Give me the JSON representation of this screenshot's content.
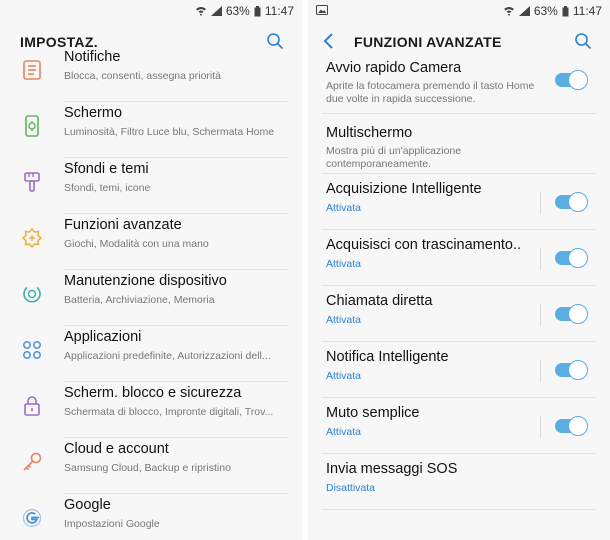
{
  "status": {
    "battery": "63%",
    "time": "11:47"
  },
  "left": {
    "title": "IMPOSTAZ.",
    "items": [
      {
        "title": "Notifiche",
        "subtitle": "Blocca, consenti, assegna priorità",
        "icon": "notifications-icon"
      },
      {
        "title": "Schermo",
        "subtitle": "Luminosità, Filtro Luce blu, Schermata Home",
        "icon": "display-icon"
      },
      {
        "title": "Sfondi e temi",
        "subtitle": "Sfondi, temi, icone",
        "icon": "paintbrush-icon"
      },
      {
        "title": "Funzioni avanzate",
        "subtitle": "Giochi, Modalità con una mano",
        "icon": "advanced-features-icon"
      },
      {
        "title": "Manutenzione dispositivo",
        "subtitle": "Batteria, Archiviazione, Memoria",
        "icon": "maintenance-icon"
      },
      {
        "title": "Applicazioni",
        "subtitle": "Applicazioni predefinite, Autorizzazioni dell...",
        "icon": "apps-icon"
      },
      {
        "title": "Scherm. blocco e sicurezza",
        "subtitle": "Schermata di blocco, Impronte digitali, Trov...",
        "icon": "lock-icon"
      },
      {
        "title": "Cloud e account",
        "subtitle": "Samsung Cloud, Backup e ripristino",
        "icon": "key-icon"
      },
      {
        "title": "Google",
        "subtitle": "Impostazioni Google",
        "icon": "google-icon"
      }
    ]
  },
  "right": {
    "title": "FUNZIONI AVANZATE",
    "items": [
      {
        "title": "Avvio rapido Camera",
        "subtitle": "Aprite la fotocamera premendo il tasto Home due volte in rapida successione.",
        "toggle": true,
        "separator": false
      },
      {
        "title": "Multischermo",
        "subtitle": "Mostra più di un'applicazione contemporaneamente.",
        "toggle": false,
        "separator": false
      },
      {
        "title": "Acquisizione Intelligente",
        "status": "Attivata",
        "toggle": true,
        "separator": true
      },
      {
        "title": "Acquisisci con trascinamento..",
        "status": "Attivata",
        "toggle": true,
        "separator": true
      },
      {
        "title": "Chiamata diretta",
        "status": "Attivata",
        "toggle": true,
        "separator": true
      },
      {
        "title": "Notifica Intelligente",
        "status": "Attivata",
        "toggle": true,
        "separator": true
      },
      {
        "title": "Muto semplice",
        "status": "Attivata",
        "toggle": true,
        "separator": true
      },
      {
        "title": "Invia messaggi SOS",
        "status": "Disattivata",
        "toggle": false,
        "separator": false
      }
    ]
  },
  "colors": {
    "accent": "#2c7fd6",
    "toggle_on": "#5aaee3",
    "icon_orange": "#e8845a",
    "icon_green": "#5cb85c",
    "icon_purple": "#9a6fc2",
    "icon_yellow": "#e8b23a",
    "icon_teal": "#3fb2a6",
    "icon_blue": "#4a8fd8"
  }
}
